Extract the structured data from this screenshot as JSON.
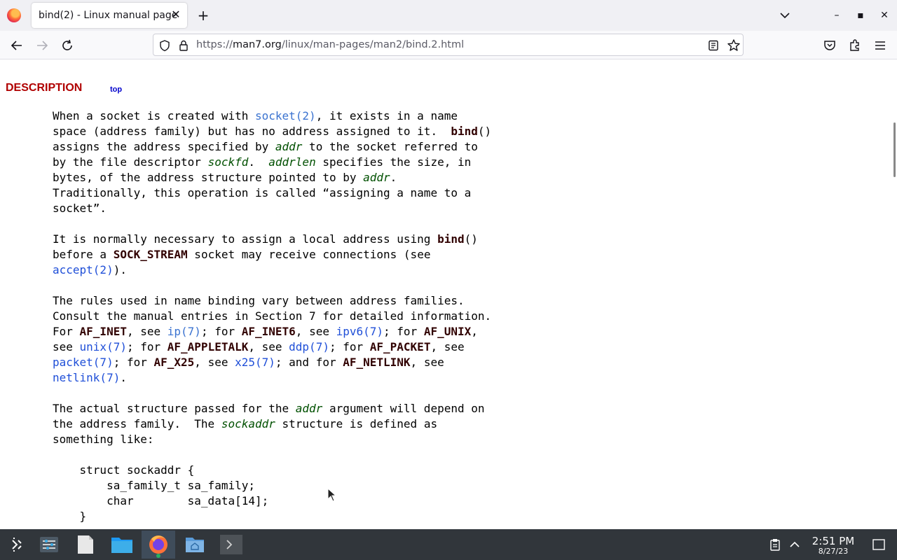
{
  "browser": {
    "tab_title": "bind(2) - Linux manual page",
    "tab_close": "✕",
    "new_tab": "+",
    "url_prefix": "https://",
    "url_domain": "man7.org",
    "url_path": "/linux/man-pages/man2/bind.2.html"
  },
  "window_controls": {
    "minimize": "–",
    "maximize": "▪",
    "close": "✕"
  },
  "page": {
    "section_heading": "DESCRIPTION",
    "top_link": "top",
    "lines": [
      [
        {
          "t": "When a socket is created with "
        },
        {
          "t": "socket(2)",
          "s": "mlink a"
        },
        {
          "t": ", it exists in a name"
        }
      ],
      [
        {
          "t": "space (address family) but has no address assigned to it.  "
        },
        {
          "t": "bind",
          "s": "bold"
        },
        {
          "t": "()"
        }
      ],
      [
        {
          "t": "assigns the address specified by "
        },
        {
          "t": "addr",
          "s": "ital"
        },
        {
          "t": " to the socket referred to"
        }
      ],
      [
        {
          "t": "by the file descriptor "
        },
        {
          "t": "sockfd",
          "s": "ital"
        },
        {
          "t": ".  "
        },
        {
          "t": "addrlen",
          "s": "ital"
        },
        {
          "t": " specifies the size, in"
        }
      ],
      [
        {
          "t": "bytes, of the address structure pointed to by "
        },
        {
          "t": "addr",
          "s": "ital"
        },
        {
          "t": "."
        }
      ],
      [
        {
          "t": "Traditionally, this operation is called “assigning a name to a"
        }
      ],
      [
        {
          "t": "socket”."
        }
      ],
      [],
      [
        {
          "t": "It is normally necessary to assign a local address using "
        },
        {
          "t": "bind",
          "s": "bold"
        },
        {
          "t": "()"
        }
      ],
      [
        {
          "t": "before a "
        },
        {
          "t": "SOCK_STREAM",
          "s": "bold"
        },
        {
          "t": " socket may receive connections (see"
        }
      ],
      [
        {
          "t": "accept(2)",
          "s": "mlink"
        },
        {
          "t": ")."
        }
      ],
      [],
      [
        {
          "t": "The rules used in name binding vary between address families."
        }
      ],
      [
        {
          "t": "Consult the manual entries in Section 7 for detailed information."
        }
      ],
      [
        {
          "t": "For "
        },
        {
          "t": "AF_INET",
          "s": "bold"
        },
        {
          "t": ", see "
        },
        {
          "t": "ip(7)",
          "s": "mlink a"
        },
        {
          "t": "; for "
        },
        {
          "t": "AF_INET6",
          "s": "bold"
        },
        {
          "t": ", see "
        },
        {
          "t": "ipv6(7)",
          "s": "mlink"
        },
        {
          "t": "; for "
        },
        {
          "t": "AF_UNIX",
          "s": "bold"
        },
        {
          "t": ","
        }
      ],
      [
        {
          "t": "see "
        },
        {
          "t": "unix(7)",
          "s": "mlink"
        },
        {
          "t": "; for "
        },
        {
          "t": "AF_APPLETALK",
          "s": "bold"
        },
        {
          "t": ", see "
        },
        {
          "t": "ddp(7)",
          "s": "mlink"
        },
        {
          "t": "; for "
        },
        {
          "t": "AF_PACKET",
          "s": "bold"
        },
        {
          "t": ", see"
        }
      ],
      [
        {
          "t": "packet(7)",
          "s": "mlink"
        },
        {
          "t": "; for "
        },
        {
          "t": "AF_X25",
          "s": "bold"
        },
        {
          "t": ", see "
        },
        {
          "t": "x25(7)",
          "s": "mlink"
        },
        {
          "t": "; and for "
        },
        {
          "t": "AF_NETLINK",
          "s": "bold"
        },
        {
          "t": ", see"
        }
      ],
      [
        {
          "t": "netlink(7)",
          "s": "mlink"
        },
        {
          "t": "."
        }
      ],
      [],
      [
        {
          "t": "The actual structure passed for the "
        },
        {
          "t": "addr",
          "s": "ital"
        },
        {
          "t": " argument will depend on"
        }
      ],
      [
        {
          "t": "the address family.  The "
        },
        {
          "t": "sockaddr",
          "s": "ital"
        },
        {
          "t": " structure is defined as"
        }
      ],
      [
        {
          "t": "something like:"
        }
      ],
      [],
      [
        {
          "t": "    struct sockaddr {"
        }
      ],
      [
        {
          "t": "        sa_family_t sa_family;"
        }
      ],
      [
        {
          "t": "        char        sa_data[14];"
        }
      ],
      [
        {
          "t": "    }"
        }
      ]
    ]
  },
  "taskbar": {
    "apps": [
      "application-launcher",
      "system-settings",
      "text-editor",
      "file-manager",
      "firefox",
      "home-folder",
      "terminal"
    ],
    "clock_time": "2:51 PM",
    "clock_date": "8/27/23"
  },
  "colors": {
    "heading": "#b00000",
    "link": "#1f4fd8",
    "bold_text": "#300000",
    "italic_text": "#005000",
    "taskbar_bg": "#31363b"
  }
}
